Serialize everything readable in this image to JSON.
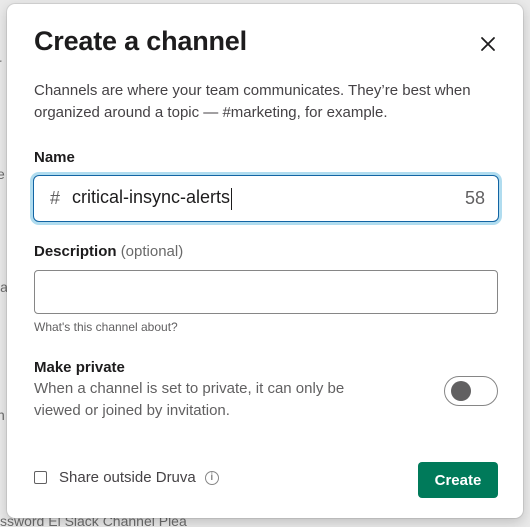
{
  "background": {
    "fragment_1": "r",
    "fragment_2": "e",
    "fragment_3": "la",
    "fragment_4": "h",
    "fragment_5": "ssword El Slack Channel Plea"
  },
  "modal": {
    "title": "Create a channel",
    "close_icon": "close-icon",
    "subtitle": "Channels are where your team communicates. They’re best when organized around a topic — #marketing, for example."
  },
  "name_field": {
    "label": "Name",
    "prefix": "#",
    "value": "critical-insync-alerts",
    "remaining_chars": "58",
    "focus_color": "#1264a3"
  },
  "description_field": {
    "label": "Description",
    "optional_text": "(optional)",
    "value": "",
    "hint": "What's this channel about?"
  },
  "privacy": {
    "label": "Make private",
    "description": "When a channel is set to private, it can only be viewed or joined by invitation.",
    "enabled": false
  },
  "footer": {
    "share_label": "Share outside Druva",
    "share_checked": false,
    "info_icon": "info-icon",
    "create_label": "Create",
    "create_color": "#007a5a"
  }
}
